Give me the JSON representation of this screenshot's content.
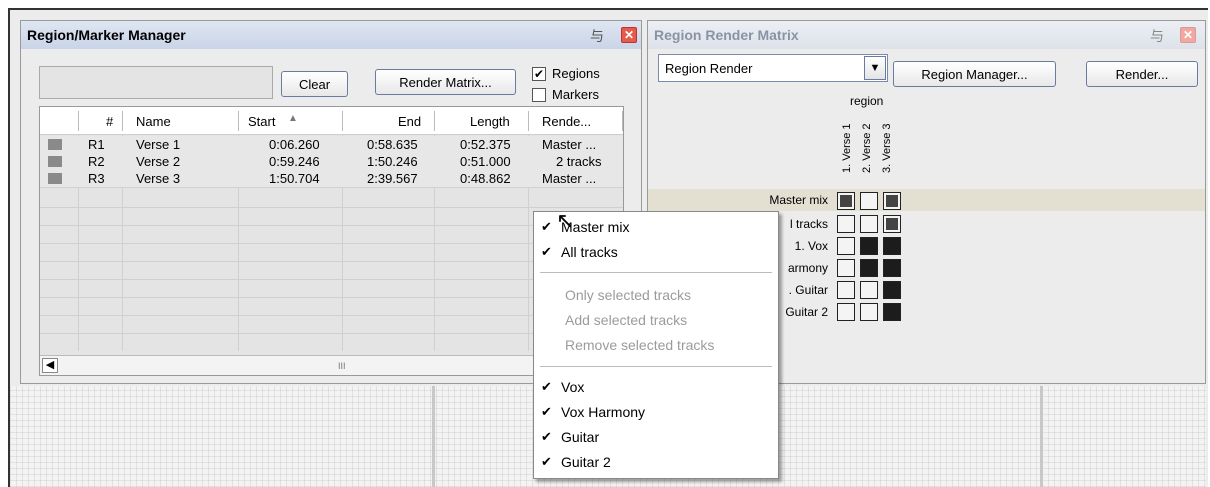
{
  "region_manager": {
    "title": "Region/Marker Manager",
    "clear_label": "Clear",
    "render_matrix_label": "Render Matrix...",
    "regions_label": "Regions",
    "markers_label": "Markers",
    "regions_checked": true,
    "markers_checked": false,
    "columns": [
      "#",
      "Name",
      "Start",
      "End",
      "Length",
      "Rende..."
    ],
    "rows": [
      {
        "num": "R1",
        "name": "Verse 1",
        "start": "0:06.260",
        "end": "0:58.635",
        "length": "0:52.375",
        "render": "Master ..."
      },
      {
        "num": "R2",
        "name": "Verse 2",
        "start": "0:59.246",
        "end": "1:50.246",
        "length": "0:51.000",
        "render": "2 tracks"
      },
      {
        "num": "R3",
        "name": "Verse 3",
        "start": "1:50.704",
        "end": "2:39.567",
        "length": "0:48.862",
        "render": "Master ..."
      }
    ],
    "scroll_grip": "III"
  },
  "render_matrix": {
    "title": "Region Render Matrix",
    "select_value": "Region Render",
    "region_manager_label": "Region Manager...",
    "render_label": "Render...",
    "region_header": "region",
    "columns": [
      "1. Verse 1",
      "2. Verse 2",
      "3. Verse 3"
    ],
    "rows": [
      {
        "label": "Master mix",
        "cells": [
          true,
          false,
          true
        ]
      },
      {
        "label": "l tracks",
        "cells": [
          false,
          false,
          true
        ]
      },
      {
        "label": "1. Vox",
        "cells": [
          false,
          true,
          true
        ]
      },
      {
        "label": "armony",
        "cells": [
          false,
          true,
          true
        ]
      },
      {
        "label": ". Guitar",
        "cells": [
          false,
          false,
          true
        ]
      },
      {
        "label": "Guitar 2",
        "cells": [
          false,
          false,
          true
        ]
      }
    ]
  },
  "context_menu": {
    "items": [
      {
        "label": "Master mix",
        "checked": true,
        "enabled": true
      },
      {
        "label": "All tracks",
        "checked": true,
        "enabled": true
      },
      {
        "label": "Only selected tracks",
        "checked": false,
        "enabled": false
      },
      {
        "label": "Add selected tracks",
        "checked": false,
        "enabled": false
      },
      {
        "label": "Remove selected tracks",
        "checked": false,
        "enabled": false
      },
      {
        "label": "Vox",
        "checked": true,
        "enabled": true
      },
      {
        "label": "Vox Harmony",
        "checked": true,
        "enabled": true
      },
      {
        "label": "Guitar",
        "checked": true,
        "enabled": true
      },
      {
        "label": "Guitar 2",
        "checked": true,
        "enabled": true
      }
    ]
  }
}
